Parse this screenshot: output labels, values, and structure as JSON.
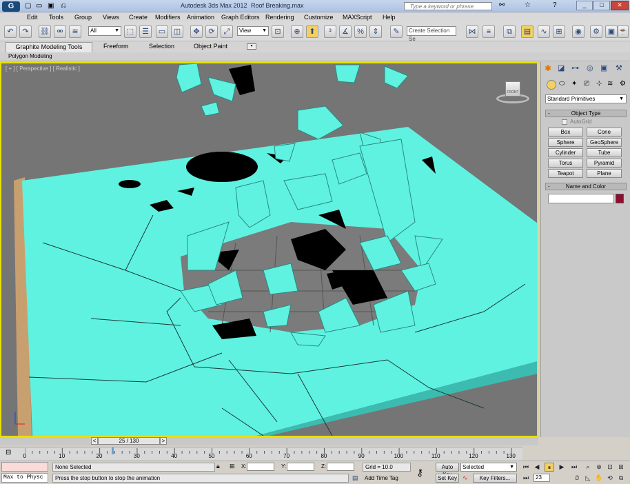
{
  "title_bar": {
    "app_title": "Autodesk 3ds Max  2012",
    "file_name": "Roof Breaking.max",
    "search_placeholder": "Type a keyword or phrase"
  },
  "menu": [
    "Edit",
    "Tools",
    "Group",
    "Views",
    "Create",
    "Modifiers",
    "Animation",
    "Graph Editors",
    "Rendering",
    "Customize",
    "MAXScript",
    "Help"
  ],
  "toolbar": {
    "filter_value": "All",
    "refcoord_value": "View",
    "named_selection_placeholder": "Create Selection Se"
  },
  "ribbon": {
    "tabs": [
      "Graphite Modeling Tools",
      "Freeform",
      "Selection",
      "Object Paint"
    ],
    "sub_label": "Polygon Modeling"
  },
  "viewport": {
    "label": "[ + ] [ Perspective ] [ Realistic ]",
    "viewcube_label": "FRONT"
  },
  "command_panel": {
    "category": "Standard Primitives",
    "object_type_title": "Object Type",
    "autogrid_label": "AutoGrid",
    "buttons": [
      "Box",
      "Cone",
      "Sphere",
      "GeoSphere",
      "Cylinder",
      "Tube",
      "Torus",
      "Pyramid",
      "Teapot",
      "Plane"
    ],
    "name_color_title": "Name and Color",
    "object_color": "#8b1030"
  },
  "timeline": {
    "frame_display": "25 / 130",
    "ticks": [
      "0",
      "10",
      "20",
      "30",
      "40",
      "50",
      "60",
      "70",
      "80",
      "90",
      "100",
      "110",
      "120",
      "130"
    ]
  },
  "status": {
    "script_label": "Max to Physc",
    "selection_status": "None Selected",
    "prompt": "Press the stop button to stop the animation",
    "x_label": "X:",
    "y_label": "Y:",
    "z_label": "Z:",
    "grid": "Grid = 10.0",
    "add_time_tag": "Add Time Tag",
    "auto_key": "Auto Key",
    "set_key": "Set Key",
    "key_mode": "Selected",
    "key_filters": "Key Filters...",
    "current_frame": "23"
  },
  "colors": {
    "accent": "#e8e000",
    "mesh": "#5ff2e0"
  }
}
